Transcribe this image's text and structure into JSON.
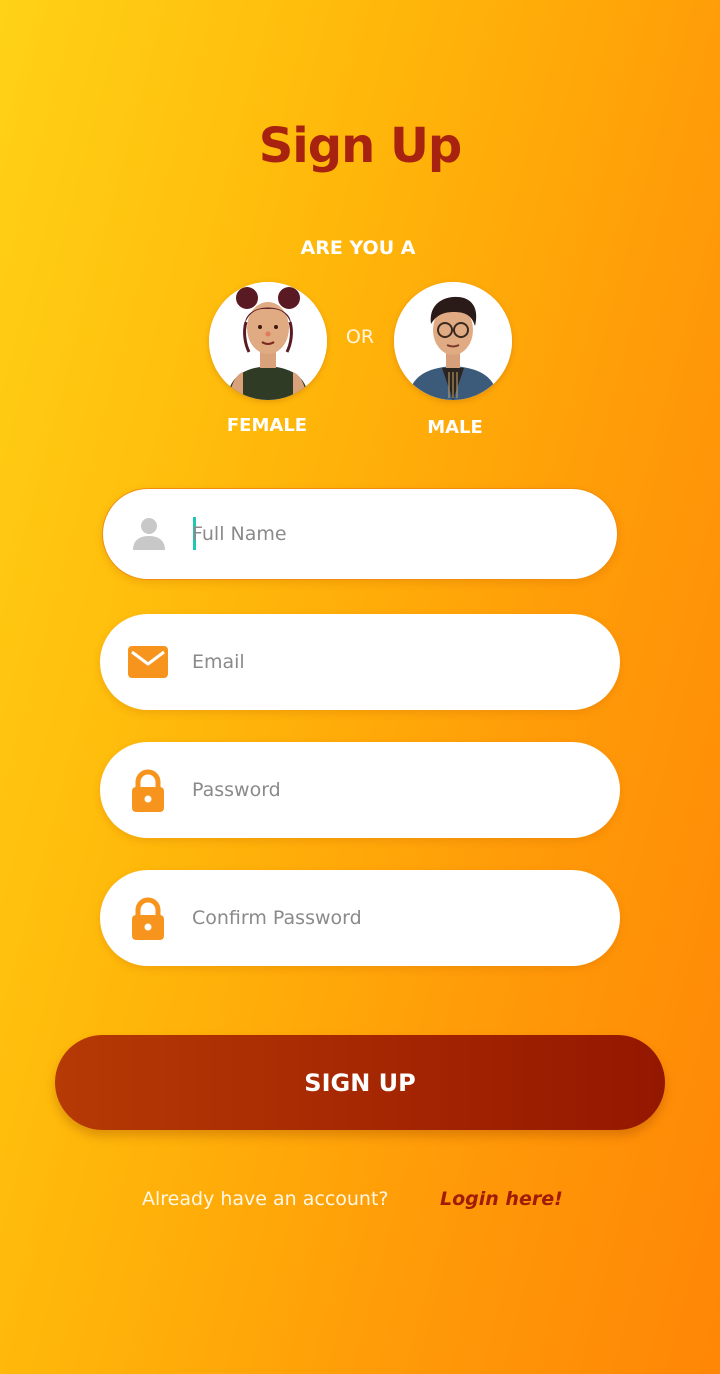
{
  "header": {
    "title": "Sign Up"
  },
  "gender_prompt": {
    "question": "ARE YOU A",
    "or_label": "OR",
    "female_label": "FEMALE",
    "male_label": "MALE"
  },
  "form": {
    "full_name": {
      "placeholder": "Full Name",
      "value": "",
      "icon": "person-icon"
    },
    "email": {
      "placeholder": "Email",
      "value": "",
      "icon": "mail-icon"
    },
    "password": {
      "placeholder": "Password",
      "value": "",
      "icon": "lock-icon"
    },
    "confirm_password": {
      "placeholder": "Confirm Password",
      "value": "",
      "icon": "lock-icon"
    }
  },
  "actions": {
    "signup_label": "SIGN UP",
    "already_text": "Already have an account?",
    "login_link": "Login here!"
  },
  "colors": {
    "title": "#a8230f",
    "accent_orange": "#f7941d",
    "button_start": "#b53a05",
    "button_end": "#941700",
    "caret": "#1ec8b4"
  }
}
